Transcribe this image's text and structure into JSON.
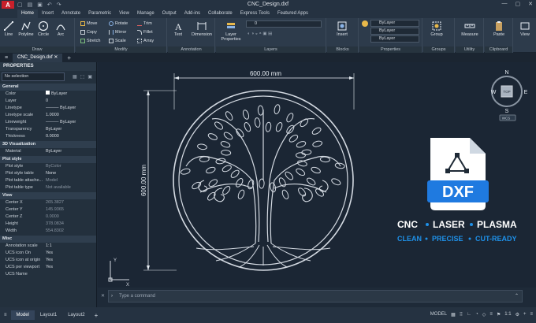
{
  "window": {
    "title": "CNC_Design.dxf",
    "logo": "A"
  },
  "menu_tabs": [
    "Home",
    "Insert",
    "Annotate",
    "Parametric",
    "View",
    "Manage",
    "Output",
    "Add-ins",
    "Collaborate",
    "Express Tools",
    "Featured Apps"
  ],
  "ribbon": {
    "draw": {
      "label": "Draw",
      "line": "Line",
      "polyline": "Polyline",
      "circle": "Circle",
      "arc": "Arc"
    },
    "modify": {
      "label": "Modify",
      "move": "Move",
      "rotate": "Rotate",
      "trim": "Trim",
      "copy": "Copy",
      "mirror": "Mirror",
      "fillet": "Fillet",
      "stretch": "Stretch",
      "scale": "Scale",
      "array": "Array"
    },
    "annotation": {
      "label": "Annotation",
      "text": "Text",
      "dimension": "Dimension"
    },
    "layers": {
      "label": "Layers",
      "layer_properties": "Layer Properties",
      "layer_value": "0"
    },
    "blocks": {
      "label": "Blocks",
      "insert": "Insert"
    },
    "properties": {
      "label": "Properties",
      "bylayer1": "ByLayer",
      "bylayer2": "ByLayer",
      "bylayer3": "ByLayer"
    },
    "groups": {
      "label": "Groups",
      "group": "Group"
    },
    "utilities": {
      "label": "Utility",
      "measure": "Measure"
    },
    "clipboard": {
      "label": "Clipboard",
      "paste": "Paste"
    },
    "view": {
      "label": "View"
    }
  },
  "doc_tab": "CNC_Design.dxf",
  "properties": {
    "title": "PROPERTIES",
    "selection": "No selection",
    "general": {
      "title": "General",
      "rows": [
        [
          "Color",
          "ByLayer"
        ],
        [
          "Layer",
          "0"
        ],
        [
          "Linetype",
          "ByLayer"
        ],
        [
          "Linetype scale",
          "1.0000"
        ],
        [
          "Lineweight",
          "ByLayer"
        ],
        [
          "Transparency",
          "ByLayer"
        ],
        [
          "Thickness",
          "0.0000"
        ]
      ]
    },
    "viz3d": {
      "title": "3D Visualization",
      "rows": [
        [
          "Material",
          "ByLayer"
        ]
      ]
    },
    "plot": {
      "title": "Plot style",
      "rows": [
        [
          "Plot style",
          "ByColor"
        ],
        [
          "Plot style table",
          "None"
        ],
        [
          "Plot table attache...",
          "Model"
        ],
        [
          "Plot table type",
          "Not available"
        ]
      ]
    },
    "view": {
      "title": "View",
      "rows": [
        [
          "Center X",
          "265.3827"
        ],
        [
          "Center Y",
          "145.9365"
        ],
        [
          "Center Z",
          "0.0000"
        ],
        [
          "Height",
          "378.0834"
        ],
        [
          "Width",
          "554.8302"
        ]
      ]
    },
    "misc": {
      "title": "Misc",
      "rows": [
        [
          "Annotation scale",
          "1:1"
        ],
        [
          "UCS icon On",
          "Yes"
        ],
        [
          "UCS icon at origin",
          "Yes"
        ],
        [
          "UCS per viewport",
          "Yes"
        ],
        [
          "UCS Name",
          ""
        ]
      ]
    }
  },
  "drawing": {
    "width_dim": "600.00 mm",
    "height_dim": "600.00 mm",
    "badge": "DXF",
    "tagline1": [
      "CNC",
      "LASER",
      "PLASMA"
    ],
    "tagline2": [
      "CLEAN",
      "PRECISE",
      "CUT-READY"
    ],
    "compass": {
      "n": "N",
      "s": "S",
      "e": "E",
      "w": "W",
      "top": "TOP",
      "wcs": "WCS"
    },
    "ucs_x": "X",
    "ucs_y": "Y"
  },
  "command_placeholder": "Type a command",
  "status": {
    "model": "Model",
    "layout1": "Layout1",
    "layout2": "Layout2",
    "right_model": "MODEL",
    "scale": "1:1"
  },
  "colors": {
    "accent": "#1f7ae0",
    "tagline_blue": "#1e90e8",
    "background": "#1b2634"
  }
}
